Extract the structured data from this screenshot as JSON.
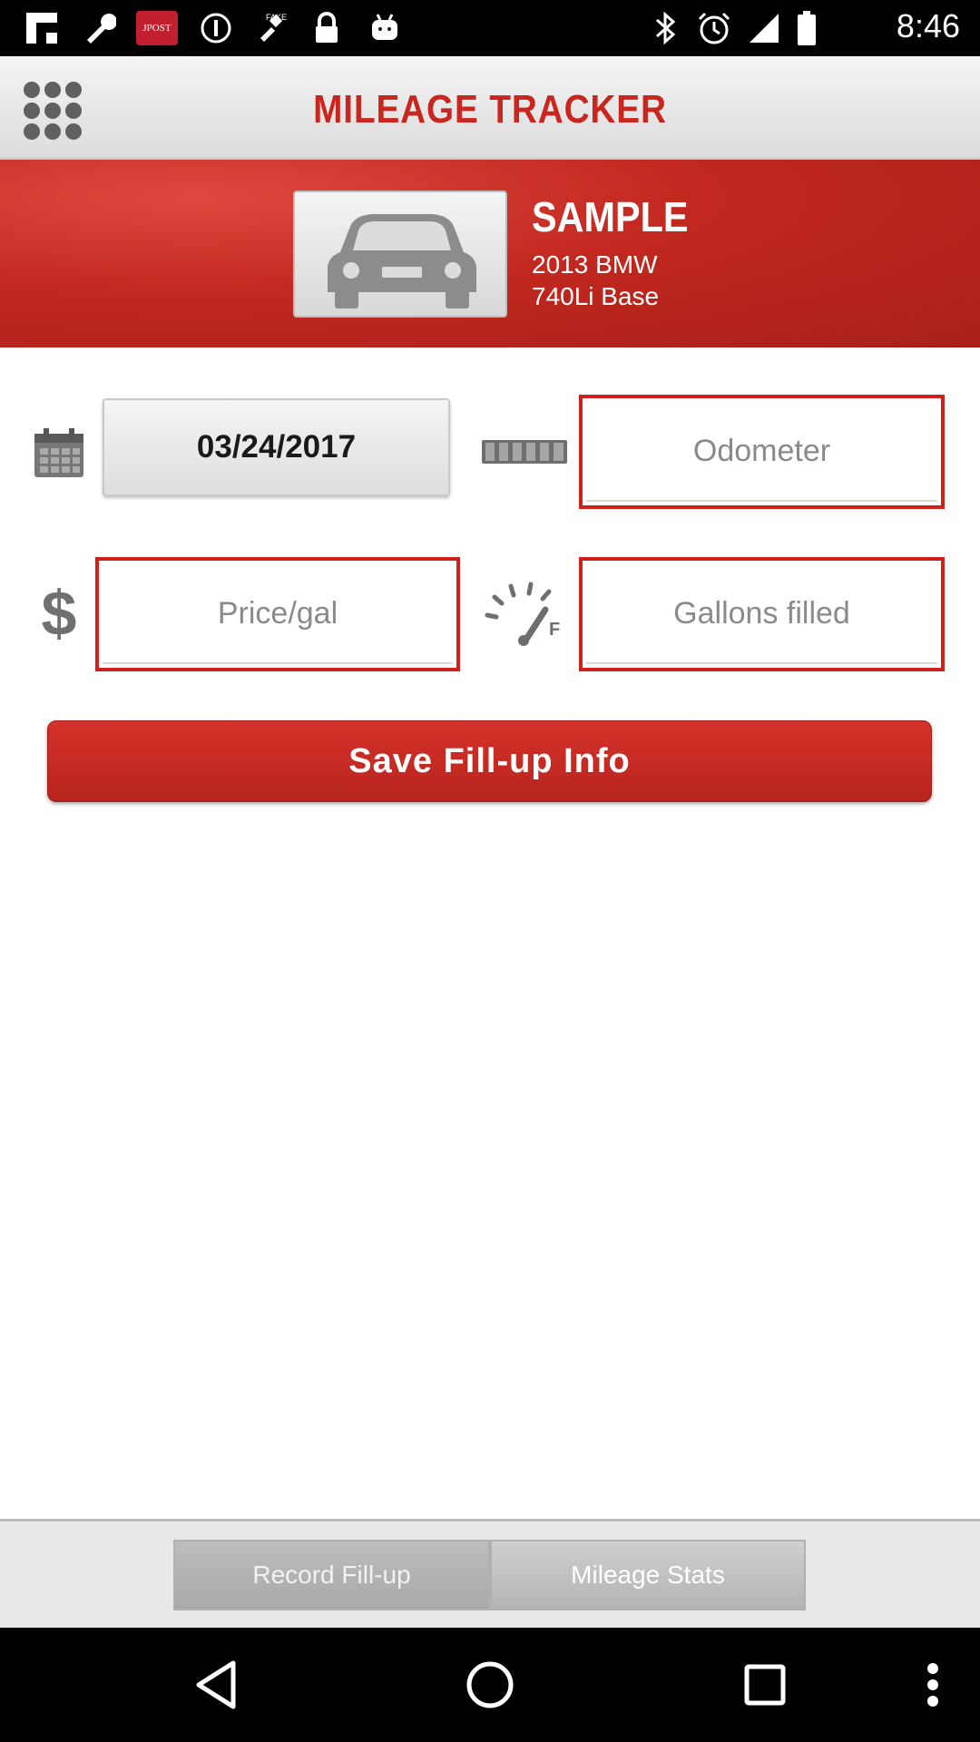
{
  "status_bar": {
    "time": "8:46",
    "left_icons": [
      "flipboard-icon",
      "wrench-icon",
      "jpost-app-icon",
      "info-icon",
      "fake-gps-icon",
      "lock-icon",
      "android-icon"
    ],
    "jpost_label": "JPOST",
    "right_icons": [
      "bluetooth-icon",
      "alarm-icon",
      "signal-icon",
      "battery-icon"
    ]
  },
  "header": {
    "title": "MILEAGE TRACKER",
    "menu_icon": "grid-menu-icon"
  },
  "vehicle": {
    "name": "SAMPLE",
    "line1": "2013 BMW",
    "line2": "740Li Base",
    "image_icon": "car-icon"
  },
  "form": {
    "date_value": "03/24/2017",
    "odometer_placeholder": "Odometer",
    "price_placeholder": "Price/gal",
    "gallons_placeholder": "Gallons filled",
    "save_label": "Save Fill-up Info",
    "icons": [
      "calendar-icon",
      "odometer-icon",
      "dollar-icon",
      "fuel-gauge-icon"
    ]
  },
  "tabs": [
    {
      "label": "Record Fill-up",
      "selected": true
    },
    {
      "label": "Mileage Stats",
      "selected": false
    }
  ],
  "nav": [
    "back-icon",
    "home-icon",
    "recents-icon",
    "more-icon"
  ],
  "colors": {
    "accent": "#c8261e",
    "input_border": "#d0201b"
  }
}
